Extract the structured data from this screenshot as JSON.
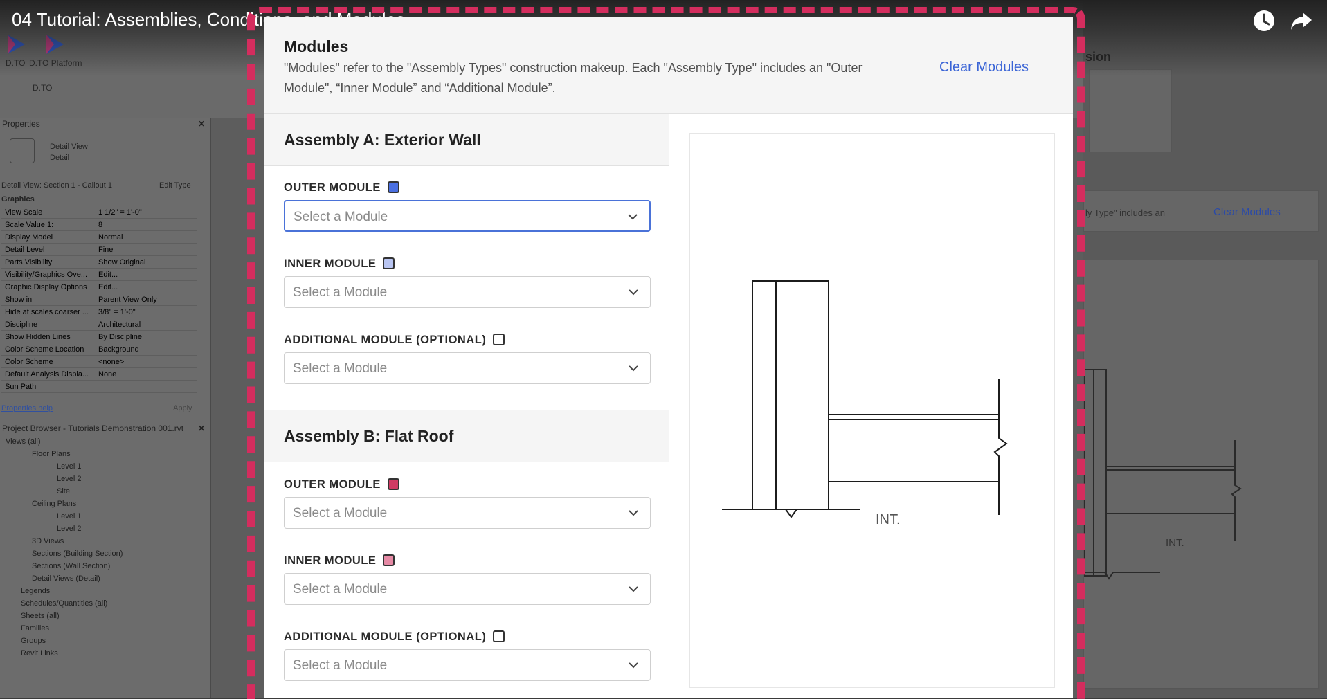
{
  "video": {
    "title": "04 Tutorial: Assemblies, Conditions, and Modules",
    "icons": [
      "watch-later-icon",
      "share-icon"
    ]
  },
  "background_app": {
    "ribbon_labels": [
      "D.TO",
      "D.TO Platform",
      "D.TO"
    ],
    "properties": {
      "title": "Properties",
      "type_name": "Detail View",
      "type_sub": "Detail",
      "instance": "Detail View: Section 1 - Callout 1",
      "edit_type": "Edit Type",
      "group": "Graphics",
      "rows": [
        {
          "k": "View Scale",
          "v": "1 1/2\" = 1'-0\""
        },
        {
          "k": "Scale Value    1:",
          "v": "8"
        },
        {
          "k": "Display Model",
          "v": "Normal"
        },
        {
          "k": "Detail Level",
          "v": "Fine"
        },
        {
          "k": "Parts Visibility",
          "v": "Show Original"
        },
        {
          "k": "Visibility/Graphics Ove...",
          "v": "Edit..."
        },
        {
          "k": "Graphic Display Options",
          "v": "Edit..."
        },
        {
          "k": "Show in",
          "v": "Parent View Only"
        },
        {
          "k": "Hide at scales coarser ...",
          "v": "3/8\" = 1'-0\""
        },
        {
          "k": "Discipline",
          "v": "Architectural"
        },
        {
          "k": "Show Hidden Lines",
          "v": "By Discipline"
        },
        {
          "k": "Color Scheme Location",
          "v": "Background"
        },
        {
          "k": "Color Scheme",
          "v": "<none>"
        },
        {
          "k": "Default Analysis Displa...",
          "v": "None"
        },
        {
          "k": "Sun Path",
          "v": ""
        }
      ],
      "help": "Properties help",
      "apply": "Apply"
    },
    "project_browser": {
      "title": "Project Browser - Tutorials Demonstration 001.rvt",
      "items": [
        "Views (all)",
        "Floor Plans",
        "Level 1",
        "Level 2",
        "Site",
        "Ceiling Plans",
        "Level 1",
        "Level 2",
        "3D Views",
        "Sections (Building Section)",
        "Sections (Wall Section)",
        "Detail Views (Detail)",
        "Legends",
        "Schedules/Quantities (all)",
        "Sheets (all)",
        "Families",
        "Groups",
        "Revit Links"
      ]
    },
    "right_panel": {
      "heading_fragment": "sion",
      "desc_fragment": "ly Type\" includes an",
      "clear_link": "Clear Modules",
      "int_label": "INT."
    }
  },
  "modal": {
    "title": "Modules",
    "description": "\"Modules\" refer to the \"Assembly Types\" construction makeup. Each \"Assembly Type\" includes an \"Outer Module\", “Inner Module” and “Additional Module”.",
    "clear_label": "Clear Modules",
    "assemblies": [
      {
        "title": "Assembly A: Exterior Wall",
        "fields": [
          {
            "label": "OUTER MODULE",
            "swatch": "#4a6fe0",
            "placeholder": "Select a Module"
          },
          {
            "label": "INNER MODULE",
            "swatch": "#b9c5f2",
            "placeholder": "Select a Module"
          },
          {
            "label": "ADDITIONAL MODULE (OPTIONAL)",
            "swatch": "#ffffff",
            "placeholder": "Select a Module"
          }
        ]
      },
      {
        "title": "Assembly B: Flat Roof",
        "fields": [
          {
            "label": "OUTER MODULE",
            "swatch": "#d03a63",
            "placeholder": "Select a Module"
          },
          {
            "label": "INNER MODULE",
            "swatch": "#e68aa5",
            "placeholder": "Select a Module"
          },
          {
            "label": "ADDITIONAL MODULE (OPTIONAL)",
            "swatch": "#ffffff",
            "placeholder": "Select a Module"
          }
        ]
      }
    ],
    "diagram": {
      "int_label": "INT."
    }
  },
  "colors": {
    "accent": "#3a64d6",
    "dashed_border": "#d42d5e",
    "focus": "#4a72d8"
  }
}
